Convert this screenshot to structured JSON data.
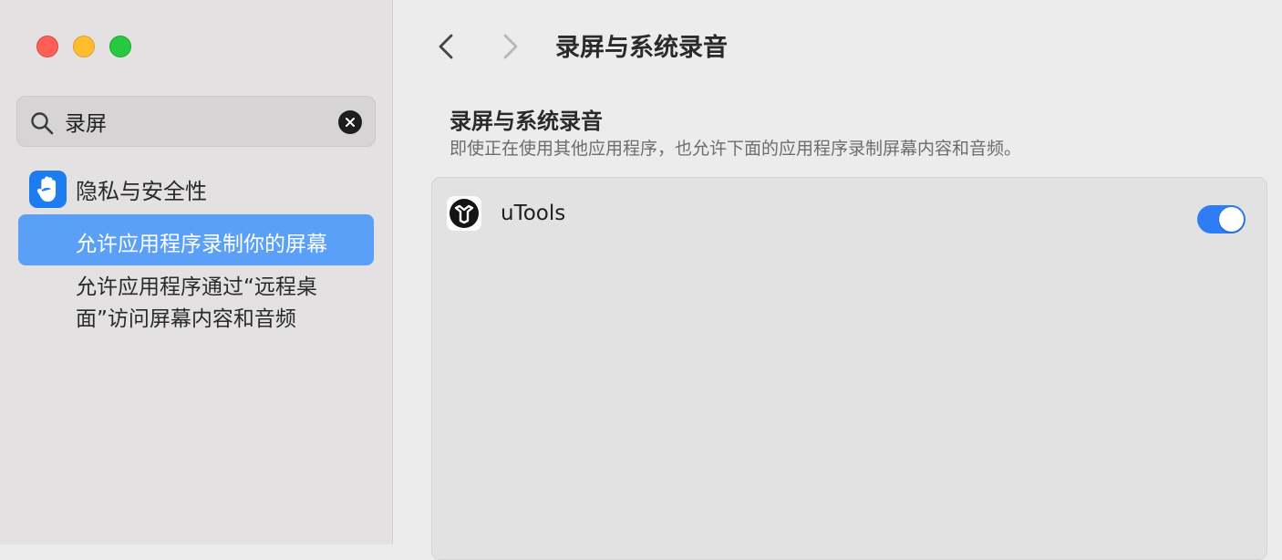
{
  "window": {
    "traffic_lights": [
      "close",
      "minimize",
      "maximize"
    ]
  },
  "sidebar": {
    "search": {
      "value": "录屏",
      "icon": "search-icon",
      "clear_icon": "close-icon"
    },
    "section": {
      "label": "隐私与安全性",
      "icon": "hand-icon",
      "icon_color": "#1e7cf1"
    },
    "items": [
      {
        "label": "允许应用程序录制你的屏幕",
        "selected": true
      },
      {
        "label": "允许应用程序通过“远程桌面”访问屏幕内容和音频",
        "selected": false
      }
    ]
  },
  "header": {
    "title": "录屏与系统录音",
    "back_icon": "chevron-left-icon",
    "forward_icon": "chevron-right-icon"
  },
  "main": {
    "section_title": "录屏与系统录音",
    "section_description": "即使正在使用其他应用程序，也允许下面的应用程序录制屏幕内容和音频。",
    "apps": [
      {
        "name": "uTools",
        "enabled": true,
        "icon": "utools-icon"
      }
    ]
  },
  "colors": {
    "accent": "#2f7df6",
    "selection": "#5aa0f8"
  }
}
